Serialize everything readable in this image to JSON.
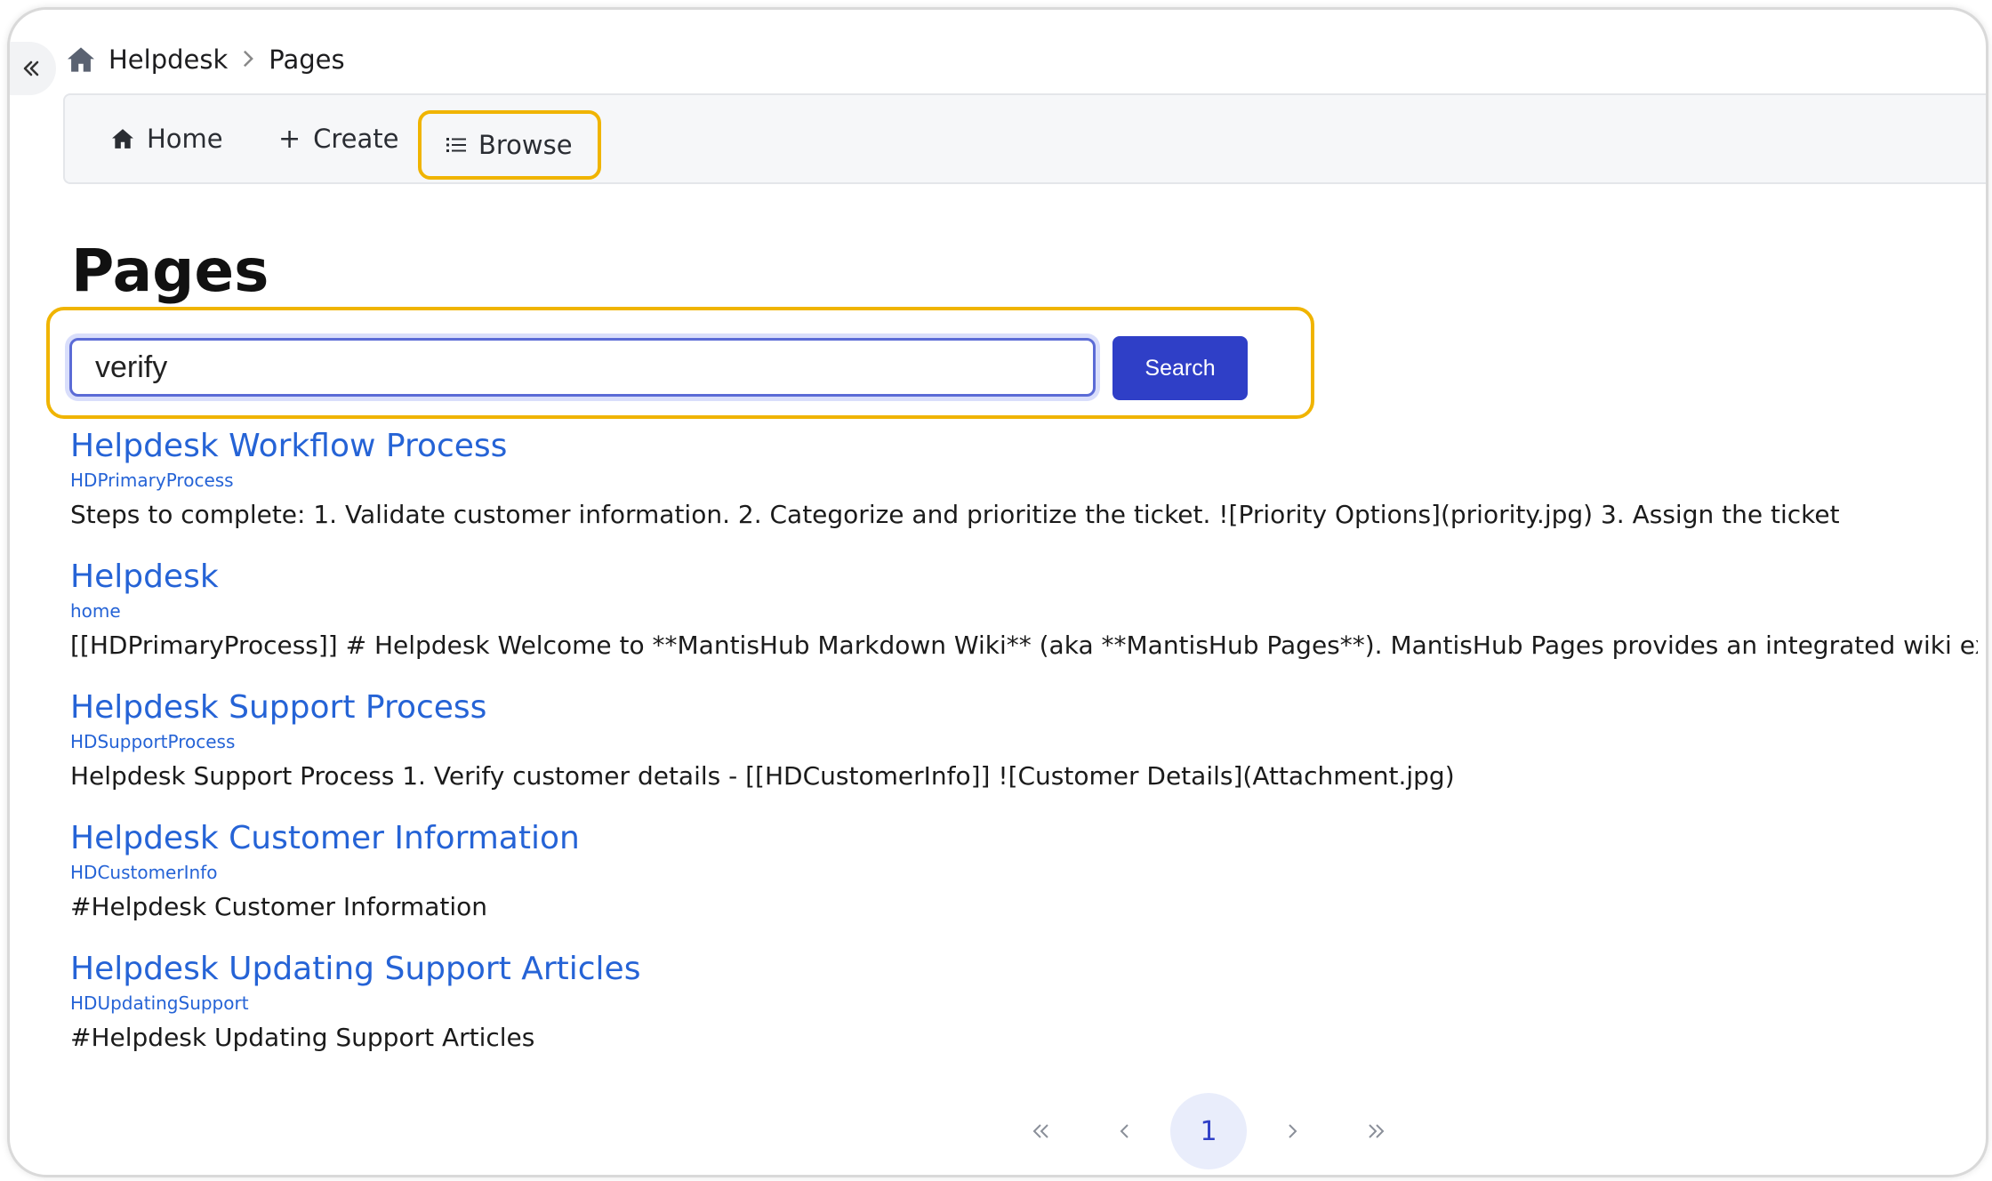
{
  "breadcrumb": {
    "items": [
      "Helpdesk",
      "Pages"
    ]
  },
  "navbar": {
    "home_label": "Home",
    "create_label": "Create",
    "browse_label": "Browse"
  },
  "page": {
    "title": "Pages"
  },
  "search": {
    "value": "verify",
    "button_label": "Search"
  },
  "results": [
    {
      "title": "Helpdesk Workflow Process",
      "slug": "HDPrimaryProcess",
      "snippet": "Steps to complete: 1. Validate customer information. 2. Categorize and prioritize the ticket. ![Priority Options](priority.jpg) 3. Assign the ticket"
    },
    {
      "title": "Helpdesk",
      "slug": "home",
      "snippet": "[[HDPrimaryProcess]] # Helpdesk Welcome to **MantisHub Markdown Wiki** (aka **MantisHub Pages**). MantisHub Pages provides an integrated wiki experi"
    },
    {
      "title": "Helpdesk Support Process",
      "slug": "HDSupportProcess",
      "snippet": "Helpdesk Support Process 1. Verify customer details - [[HDCustomerInfo]] ![Customer Details](Attachment.jpg)"
    },
    {
      "title": "Helpdesk Customer Information",
      "slug": "HDCustomerInfo",
      "snippet": "#Helpdesk Customer Information"
    },
    {
      "title": "Helpdesk Updating Support Articles",
      "slug": "HDUpdatingSupport",
      "snippet": "#Helpdesk Updating Support Articles"
    }
  ],
  "pagination": {
    "current_page": "1"
  },
  "colors": {
    "accent": "#2f3fc7",
    "link": "#2563d6",
    "highlight": "#f0b400"
  }
}
